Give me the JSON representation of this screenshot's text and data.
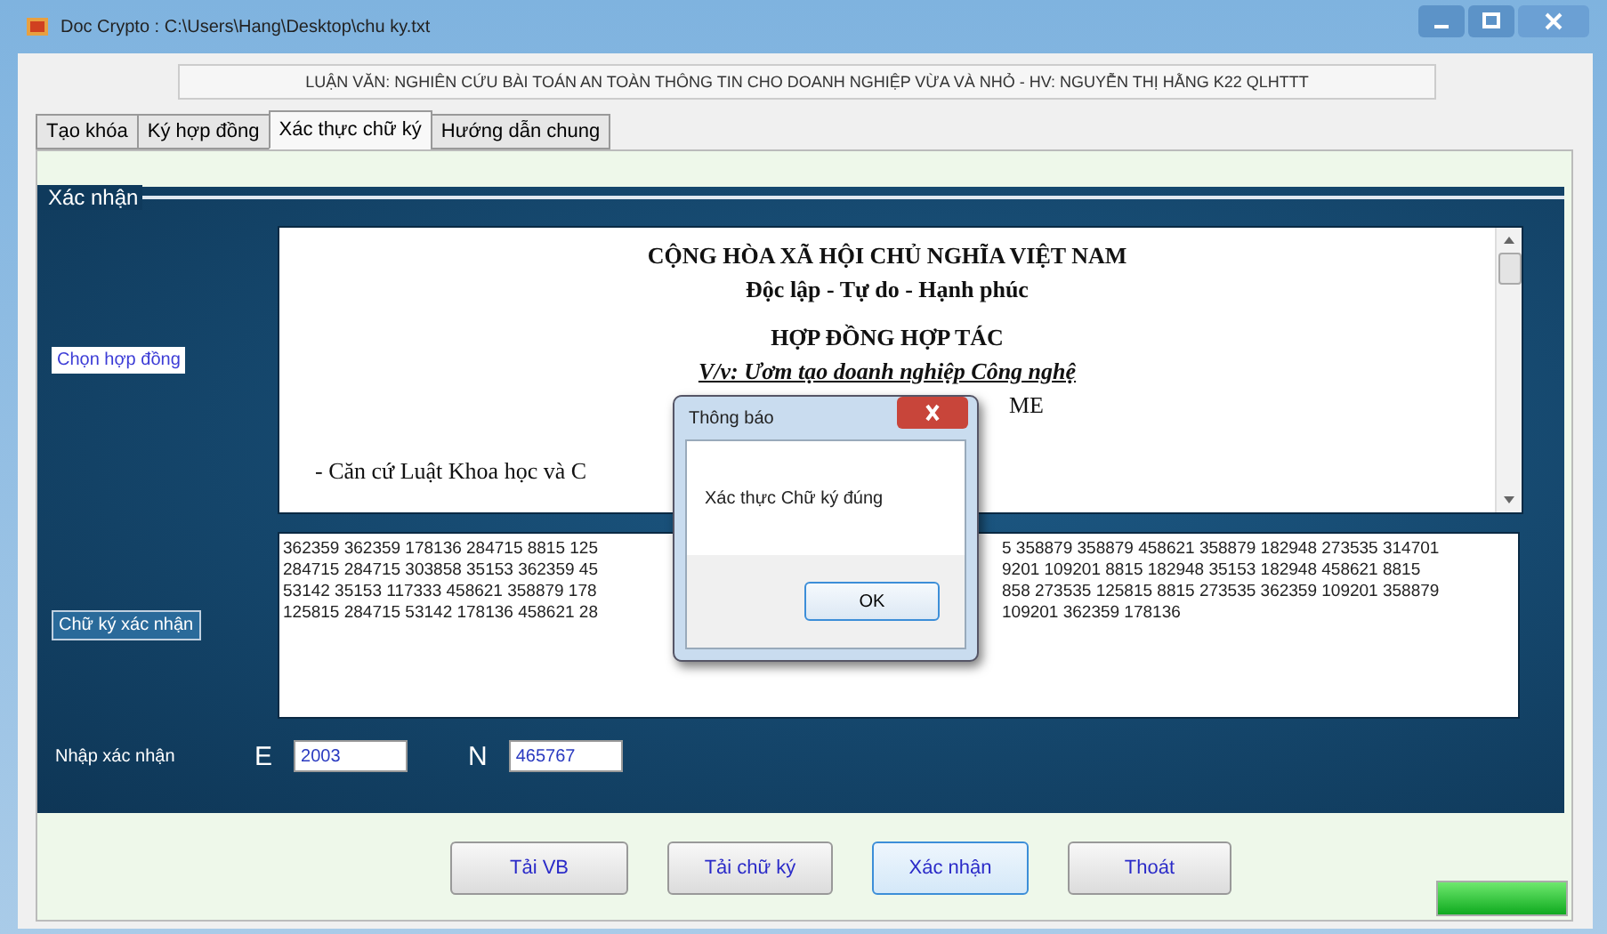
{
  "window": {
    "title": "Doc Crypto : C:\\Users\\Hang\\Desktop\\chu ky.txt"
  },
  "header": "LUẬN VĂN: NGHIÊN CỨU BÀI TOÁN AN TOÀN THÔNG TIN CHO DOANH NGHIỆP VỪA VÀ NHỎ - HV: NGUYỄN THỊ HẰNG K22 QLHTTT",
  "tabs": [
    {
      "label": "Tạo khóa",
      "selected": false
    },
    {
      "label": "Ký hợp đồng",
      "selected": false
    },
    {
      "label": "Xác thực chữ ký",
      "selected": true
    },
    {
      "label": "Hướng dẫn chung",
      "selected": false
    }
  ],
  "group": {
    "legend": "Xác nhận",
    "choose_contract": "Chọn hợp đồng",
    "document_lines": [
      {
        "kind": "title",
        "text": "CỘNG HÒA XÃ HỘI CHỦ NGHĨA VIỆT NAM"
      },
      {
        "kind": "title",
        "text": "Độc lập - Tự do - Hạnh phúc"
      },
      {
        "kind": "heading",
        "text": "HỢP ĐỒNG HỢP TÁC"
      },
      {
        "kind": "subject",
        "text": "V/v: Ươm tạo doanh nghiệp Công nghệ"
      },
      {
        "kind": "right",
        "text": "ME"
      },
      {
        "kind": "bullet",
        "text": "-    Căn cứ Luật Khoa học và C"
      }
    ],
    "signature_label": "Chữ ký xác nhận",
    "signature_lines": [
      {
        "left": "362359 362359 178136 284715 8815 125",
        "right": "5 358879 358879 458621 358879 182948 273535 314701"
      },
      {
        "left": "284715 284715 303858 35153 362359 45",
        "right": "9201 109201 8815 182948 35153 182948 458621 8815"
      },
      {
        "left": "53142 35153 117333 458621 358879 178",
        "right": "858 273535 125815 8815 273535 362359 109201 358879"
      },
      {
        "left": "125815 284715 53142 178136 458621 28",
        "right": "109201 362359 178136"
      }
    ],
    "input_label": "Nhập xác nhận",
    "e_label": "E",
    "e_value": "2003",
    "n_label": "N",
    "n_value": "465767"
  },
  "buttons": [
    {
      "label": "Tải VB",
      "focused": false
    },
    {
      "label": "Tải chữ ký",
      "focused": false
    },
    {
      "label": "Xác nhận",
      "focused": true
    },
    {
      "label": "Thoát",
      "focused": false
    }
  ],
  "progress": {
    "level": 1
  },
  "dialog": {
    "title": "Thông báo",
    "message": "Xác thực Chữ ký đúng",
    "button": "OK"
  }
}
